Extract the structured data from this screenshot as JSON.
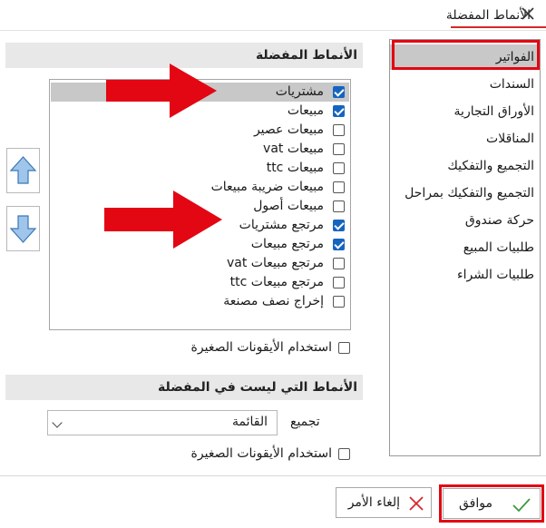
{
  "window": {
    "title_tab": "الأنماط المفضلة"
  },
  "categories": [
    {
      "label": "الفواتير",
      "selected": true
    },
    {
      "label": "السندات"
    },
    {
      "label": "الأوراق التجارية"
    },
    {
      "label": "المناقلات"
    },
    {
      "label": "التجميع والتفكيك"
    },
    {
      "label": "التجميع والتفكيك بمراحل"
    },
    {
      "label": "حركة صندوق"
    },
    {
      "label": "طلبيات المبيع"
    },
    {
      "label": "طلبيات الشراء"
    }
  ],
  "favorites_section": {
    "header": "الأنماط المفضلة",
    "items": [
      {
        "label": "مشتريات",
        "checked": true,
        "selected": true
      },
      {
        "label": "مبيعات",
        "checked": true
      },
      {
        "label": "مبيعات عصير",
        "checked": false
      },
      {
        "label": "مبيعات vat",
        "checked": false
      },
      {
        "label": "مبيعات ttc",
        "checked": false
      },
      {
        "label": "مبيعات ضريبة مبيعات",
        "checked": false
      },
      {
        "label": "مبيعات أصول",
        "checked": false
      },
      {
        "label": "مرتجع مشتريات",
        "checked": true
      },
      {
        "label": "مرتجع مبيعات",
        "checked": true
      },
      {
        "label": "مرتجع مبيعات vat",
        "checked": false
      },
      {
        "label": "مرتجع مبيعات ttc",
        "checked": false
      },
      {
        "label": "إخراج نصف مصنعة",
        "checked": false
      }
    ],
    "small_icons_label": "استخدام الأيقونات الصغيرة"
  },
  "non_favorites_section": {
    "header": "الأنماط التي ليست في المفضلة",
    "group_label": "تجميع",
    "group_value": "القائمة",
    "small_icons_label": "استخدام الأيقونات الصغيرة"
  },
  "buttons": {
    "ok": "موافق",
    "cancel": "إلغاء الأمر"
  },
  "colors": {
    "accent_red": "#e30613",
    "checkbox_blue": "#1565c0",
    "selection_gray": "#c8c8c8",
    "arrow_blue": "#5b9bd5"
  }
}
